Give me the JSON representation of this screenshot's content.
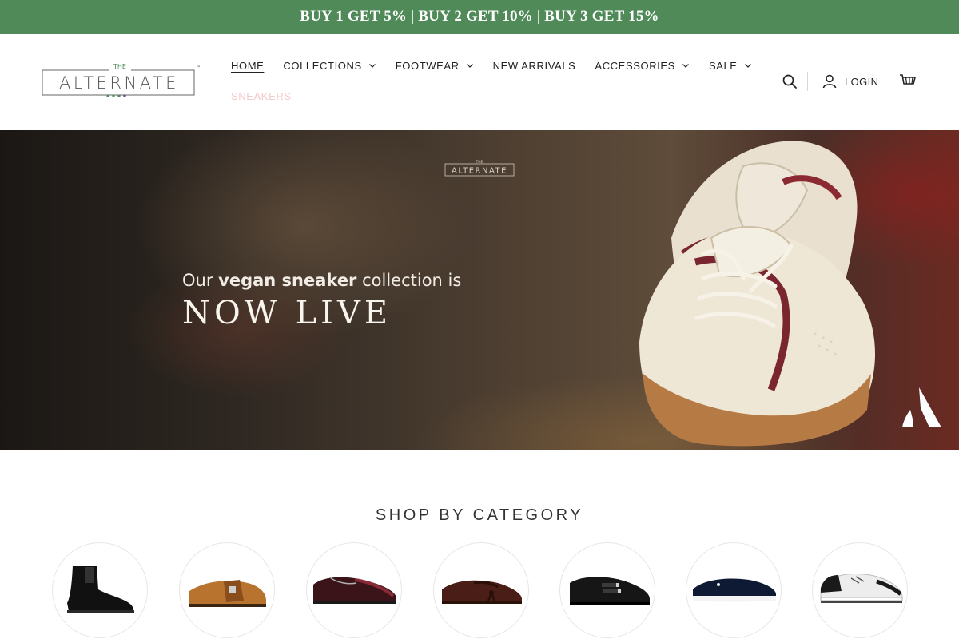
{
  "announcement": {
    "text": "BUY 1 GET 5% | BUY 2 GET 10% | BUY 3 GET 15%"
  },
  "brand": {
    "name": "THE ALTERNATE",
    "logo_top": "THE",
    "logo_main": "ALTERNATE",
    "trademark": "™"
  },
  "nav": {
    "items": [
      {
        "label": "HOME",
        "active": true,
        "dropdown": false
      },
      {
        "label": "COLLECTIONS",
        "dropdown": true
      },
      {
        "label": "FOOTWEAR",
        "dropdown": true
      },
      {
        "label": "NEW ARRIVALS",
        "dropdown": false
      },
      {
        "label": "ACCESSORIES",
        "dropdown": true
      },
      {
        "label": "SALE",
        "dropdown": true
      }
    ],
    "secondary": "SNEAKERS"
  },
  "header_actions": {
    "search_icon": "search-icon",
    "login_label": "LOGIN",
    "cart_icon": "cart-icon"
  },
  "hero": {
    "line1_pre": "Our ",
    "line1_bold": "vegan sneaker",
    "line1_post": " collection is",
    "line2": "NOW LIVE",
    "logo_text": "ALTERNATE"
  },
  "categories": {
    "title": "SHOP BY CATEGORY",
    "items": [
      {
        "name": "chelsea-boot-icon"
      },
      {
        "name": "tan-monk-strap-icon"
      },
      {
        "name": "oxford-brogue-icon"
      },
      {
        "name": "tassel-loafer-icon"
      },
      {
        "name": "double-monk-icon"
      },
      {
        "name": "suede-loafer-sneaker-icon"
      },
      {
        "name": "white-sneaker-icon"
      }
    ]
  },
  "colors": {
    "announce_bg": "#4f8a58",
    "accent_green": "#4f8a58",
    "sale_pink": "#f3c9c9"
  }
}
